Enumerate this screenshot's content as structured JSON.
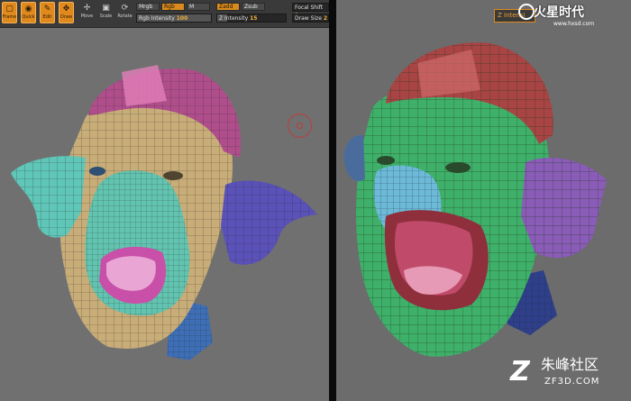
{
  "toolbar": {
    "tools": [
      {
        "label": "Frame",
        "glyph": "▢",
        "active": true
      },
      {
        "label": "Quick",
        "glyph": "◉",
        "active": true
      },
      {
        "label": "Edit",
        "glyph": "✎",
        "active": true
      },
      {
        "label": "Draw",
        "glyph": "✥",
        "active": true
      },
      {
        "label": "Move",
        "glyph": "✢",
        "active": false
      },
      {
        "label": "Scale",
        "glyph": "▣",
        "active": false
      },
      {
        "label": "Rotate",
        "glyph": "⟳",
        "active": false
      }
    ],
    "modes": {
      "mrgb": "Mrgb",
      "rgb": "Rgb",
      "m": "M",
      "zadd": "Zadd",
      "zsub": "Zsub"
    },
    "rgb_intensity": {
      "label": "Rgb Intensity",
      "value": "100"
    },
    "z_intensity": {
      "label": "Z Intensity",
      "value": "15"
    },
    "focal_shift": {
      "label": "Focal Shift",
      "value": "2"
    },
    "draw_size": {
      "label": "Draw Size",
      "value": "2"
    }
  },
  "right_panel": {
    "z_intensity_label": "Z Intensi"
  },
  "watermarks": {
    "top_name": "火星时代",
    "top_url": "www.hxsd.com",
    "bottom_mark": "Z",
    "bottom_name": "朱峰社区",
    "bottom_url": "ZF3D.COM"
  },
  "colors": {
    "accent": "#e08a1e",
    "viewport_bg": "#6f6f6f",
    "toolbar_bg": "#3a3a3a"
  }
}
